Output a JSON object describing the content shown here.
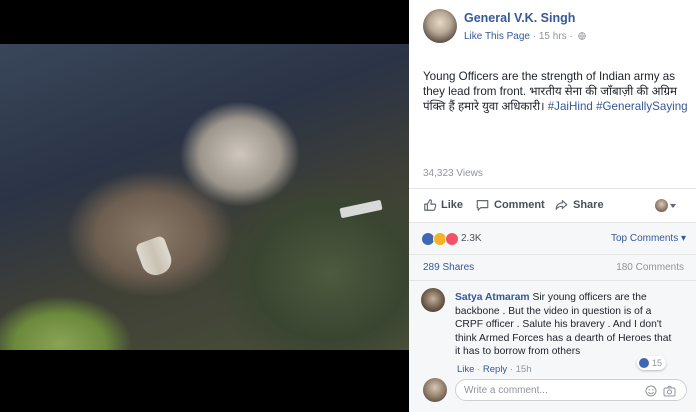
{
  "post": {
    "author": "General V.K. Singh",
    "like_page": "Like This Page",
    "time": "15 hrs",
    "separator": "·",
    "text": "Young Officers are the strength of Indian army as they lead from front. भारतीय सेना की जाँबाज़ी की अग्रिम पंक्ति हैं हमारे युवा अधिकारी।",
    "hashtags": [
      "#JaiHind",
      "#GenerallySaying"
    ],
    "views": "34,323 Views"
  },
  "actions": {
    "like": "Like",
    "comment": "Comment",
    "share": "Share"
  },
  "reactions": {
    "count": "2.3K",
    "top_comments": "Top Comments ▾",
    "icons": [
      "like-icon",
      "wow-icon",
      "love-icon"
    ]
  },
  "stats": {
    "shares": "289 Shares",
    "comments": "180 Comments"
  },
  "comment": {
    "name": "Satya Atmaram",
    "text": "Sir young officers are the backbone . But the video in question is of a CRPF officer . Salute his bravery . And I don't think Armed Forces has a dearth of Heroes that it has to borrow from others",
    "like": "Like",
    "reply": "Reply",
    "time": "15h",
    "likes": "15"
  },
  "composer": {
    "placeholder": "Write a comment..."
  },
  "colors": {
    "link": "#365899",
    "muted": "#90949c",
    "panel_bg": "#f6f7f9"
  }
}
